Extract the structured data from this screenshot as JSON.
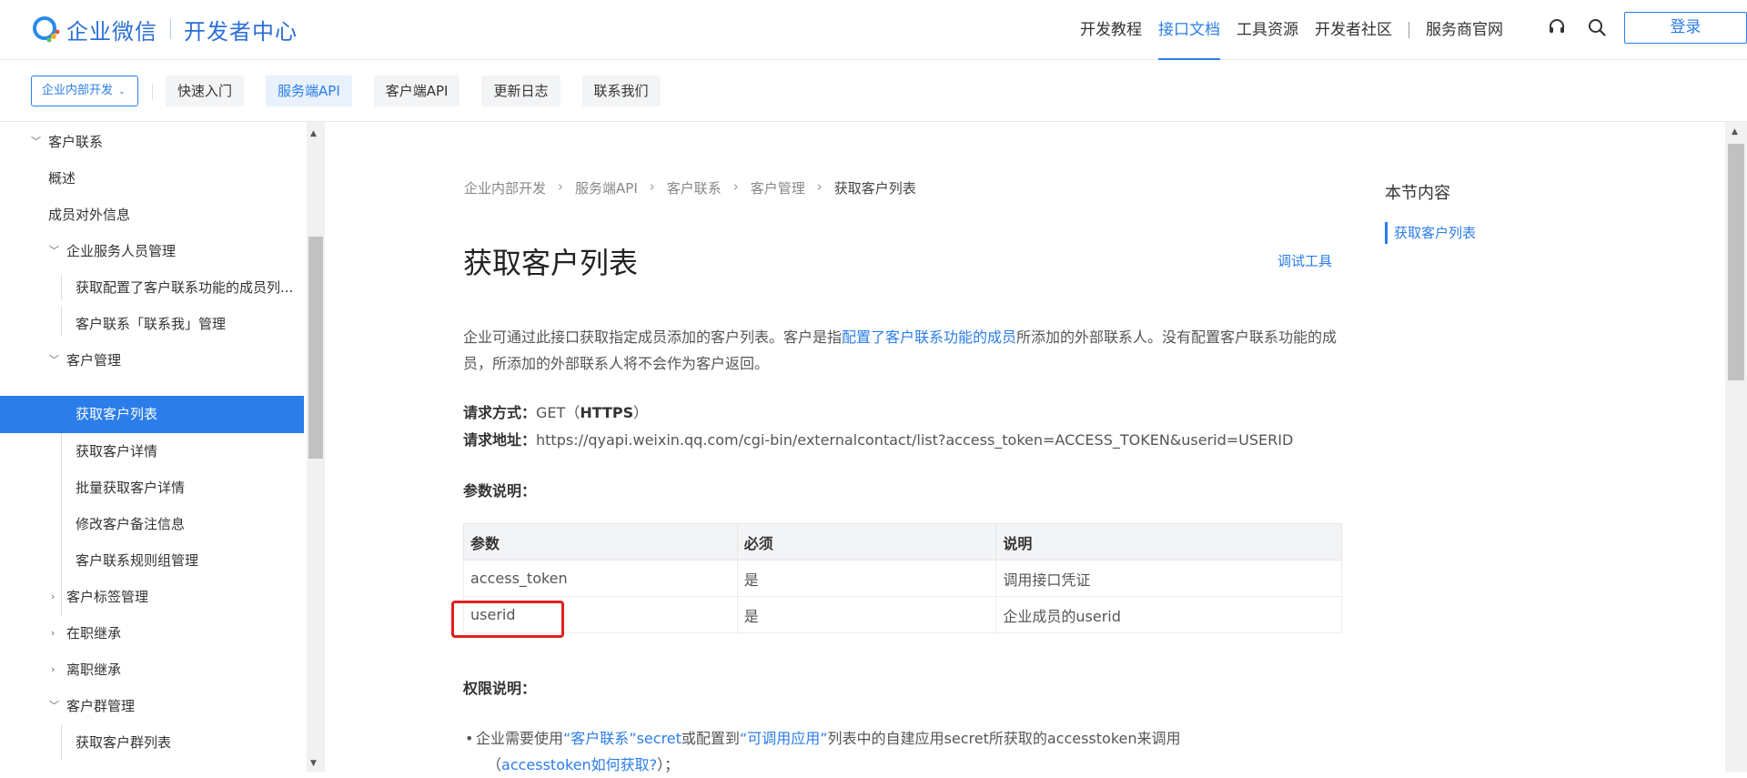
{
  "header": {
    "brand": "企业微信",
    "sub_brand": "开发者中心",
    "nav": [
      "开发教程",
      "接口文档",
      "工具资源",
      "开发者社区",
      "服务商官网"
    ],
    "nav_active": "接口文档",
    "login_label": "登录",
    "icons": [
      "headset-icon",
      "search-icon"
    ]
  },
  "subnav": {
    "scope": "企业内部开发",
    "tabs": [
      "快速入门",
      "服务端API",
      "客户端API",
      "更新日志",
      "联系我们"
    ],
    "active_tab": "服务端API"
  },
  "sidebar": {
    "items": [
      {
        "label": "客户联系",
        "caret": "down"
      },
      {
        "label": "概述"
      },
      {
        "label": "成员对外信息"
      },
      {
        "label": "企业服务人员管理",
        "caret": "down"
      },
      {
        "label": "获取配置了客户联系功能的成员列..."
      },
      {
        "label": "客户联系「联系我」管理"
      },
      {
        "label": "客户管理",
        "caret": "down"
      },
      {
        "label": "获取客户列表",
        "active": true
      },
      {
        "label": "获取客户详情"
      },
      {
        "label": "批量获取客户详情"
      },
      {
        "label": "修改客户备注信息"
      },
      {
        "label": "客户联系规则组管理"
      },
      {
        "label": "客户标签管理",
        "caret": "right"
      },
      {
        "label": "在职继承",
        "caret": "right"
      },
      {
        "label": "离职继承",
        "caret": "right"
      },
      {
        "label": "客户群管理",
        "caret": "down"
      },
      {
        "label": "获取客户群列表"
      }
    ]
  },
  "main": {
    "breadcrumb": [
      "企业内部开发",
      "服务端API",
      "客户联系",
      "客户管理",
      "获取客户列表"
    ],
    "title": "获取客户列表",
    "debug_tool": "调试工具",
    "desc_part1": "企业可通过此接口获取指定成员添加的客户列表。客户是指",
    "desc_link": "配置了客户联系功能的成员",
    "desc_part2": "所添加的外部联系人。没有配置客户联系功能的成员，所添加的外部联系人将不会作为客户返回。",
    "req_method_label": "请求方式：",
    "req_method": "GET（",
    "req_method_https": "HTTPS",
    "req_method_end": "）",
    "req_url_label": "请求地址：",
    "req_url": "https://qyapi.weixin.qq.com/cgi-bin/externalcontact/list?access_token=ACCESS_TOKEN&userid=USERID",
    "params_heading": "参数说明：",
    "table": {
      "headers": [
        "参数",
        "必须",
        "说明"
      ],
      "rows": [
        [
          "access_token",
          "是",
          "调用接口凭证"
        ],
        [
          "userid",
          "是",
          "企业成员的userid"
        ]
      ]
    },
    "perm_heading": "权限说明：",
    "perm_text1": "企业需要使用",
    "perm_link1": "“客户联系”secret",
    "perm_text2": "或配置到",
    "perm_link2": "“可调用应用”",
    "perm_text3": "列表中的自建应用secret所获取的accesstoken来调用",
    "perm_text4": "（",
    "perm_link3": "accesstoken如何获取?",
    "perm_text5": "）；"
  },
  "toc": {
    "title": "本节内容",
    "items": [
      "获取客户列表"
    ]
  }
}
